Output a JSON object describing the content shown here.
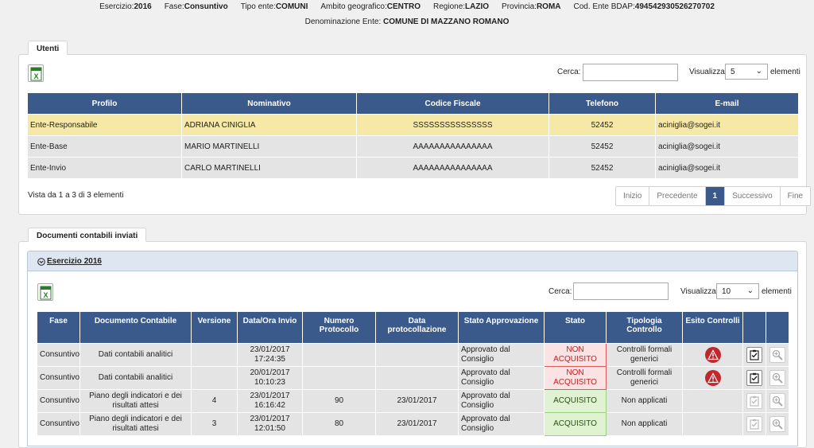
{
  "header": {
    "line1": [
      {
        "label": "Esercizio:",
        "value": "2016"
      },
      {
        "label": "Fase:",
        "value": "Consuntivo"
      },
      {
        "label": "Tipo ente:",
        "value": "COMUNI"
      },
      {
        "label": "Ambito geografico:",
        "value": "CENTRO"
      },
      {
        "label": "Regione:",
        "value": "LAZIO"
      },
      {
        "label": "Provincia:",
        "value": "ROMA"
      },
      {
        "label": "Cod. Ente BDAP:",
        "value": "494542930526270702"
      }
    ],
    "line2": {
      "label": "Denominazione Ente:",
      "value": "COMUNE DI MAZZANO ROMANO"
    }
  },
  "utenti": {
    "tab_label": "Utenti",
    "search_label": "Cerca:",
    "search_value": "",
    "show_label": "Visualizza",
    "show_value": "5",
    "show_suffix": "elementi",
    "columns": [
      "Profilo",
      "Nominativo",
      "Codice Fiscale",
      "Telefono",
      "E-mail"
    ],
    "rows": [
      [
        "Ente-Responsabile",
        "ADRIANA CINIGLIA",
        "SSSSSSSSSSSSSSS",
        "52452",
        "aciniglia@sogei.it"
      ],
      [
        "Ente-Base",
        "MARIO MARTINELLI",
        "AAAAAAAAAAAAAAA",
        "52452",
        "aciniglia@sogei.it"
      ],
      [
        "Ente-Invio",
        "CARLO MARTINELLI",
        "AAAAAAAAAAAAAAA",
        "52452",
        "aciniglia@sogei.it"
      ]
    ],
    "info": "Vista da 1 a 3 di 3 elementi",
    "pager": [
      "Inizio",
      "Precedente",
      "1",
      "Successivo",
      "Fine"
    ]
  },
  "documenti": {
    "tab_label": "Documenti contabili inviati",
    "accordion_title": "Esercizio 2016",
    "search_label": "Cerca:",
    "search_value": "",
    "show_label": "Visualizza",
    "show_value": "10",
    "show_suffix": "elementi",
    "columns": [
      "Fase",
      "Documento Contabile",
      "Versione",
      "Data/Ora Invio",
      "Numero Protocollo",
      "Data protocollazione",
      "Stato Approvazione",
      "Stato",
      "Tipologia Controllo",
      "Esito Controlli",
      "",
      ""
    ],
    "rows": [
      {
        "fase": "Consuntivo",
        "doc": "Dati contabili analitici",
        "versione": "",
        "data": "23/01/2017 17:24:35",
        "protocollo": "",
        "data_prot": "",
        "approvazione": "Approvato dal Consiglio",
        "stato": "NON ACQUISITO",
        "stato_ok": false,
        "tipologia": "Controlli formali generici",
        "esito": "warning-icon"
      },
      {
        "fase": "Consuntivo",
        "doc": "Dati contabili analitici",
        "versione": "",
        "data": "20/01/2017 10:10:23",
        "protocollo": "",
        "data_prot": "",
        "approvazione": "Approvato dal Consiglio",
        "stato": "NON ACQUISITO",
        "stato_ok": false,
        "tipologia": "Controlli formali generici",
        "esito": "warning-icon"
      },
      {
        "fase": "Consuntivo",
        "doc": "Piano degli indicatori e dei risultati attesi",
        "versione": "4",
        "data": "23/01/2017 16:16:42",
        "protocollo": "90",
        "data_prot": "23/01/2017",
        "approvazione": "Approvato dal Consiglio",
        "stato": "ACQUISITO",
        "stato_ok": true,
        "tipologia": "Non applicati",
        "esito": ""
      },
      {
        "fase": "Consuntivo",
        "doc": "Piano degli indicatori e dei risultati attesi",
        "versione": "3",
        "data": "23/01/2017 12:01:50",
        "protocollo": "80",
        "data_prot": "23/01/2017",
        "approvazione": "Approvato dal Consiglio",
        "stato": "ACQUISITO",
        "stato_ok": true,
        "tipologia": "Non applicati",
        "esito": ""
      }
    ]
  },
  "colors": {
    "header_blue": "#3a5a8c",
    "highlight": "#f6e9a8",
    "error_red": "#c0282d",
    "ok_green": "#dff2d2"
  }
}
